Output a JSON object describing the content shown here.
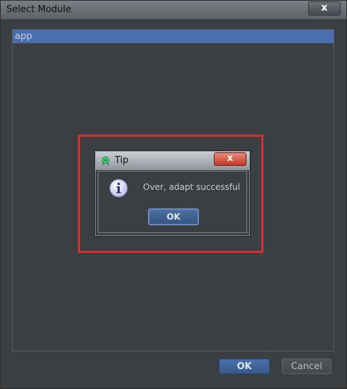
{
  "window": {
    "title": "Select Module",
    "close_label": "x",
    "list": {
      "items": [
        {
          "label": "app",
          "selected": true
        }
      ]
    },
    "ok_label": "OK",
    "cancel_label": "Cancel"
  },
  "tip_dialog": {
    "title": "Tip",
    "close_label": "x",
    "message": "Over, adapt successful",
    "ok_label": "OK",
    "icon": "info-icon"
  },
  "colors": {
    "window_bg": "#3c3f41",
    "selection": "#4b6eaf",
    "highlight": "#d63031",
    "primary_button": "#4a6fa8",
    "tip_close": "#c63a26"
  }
}
